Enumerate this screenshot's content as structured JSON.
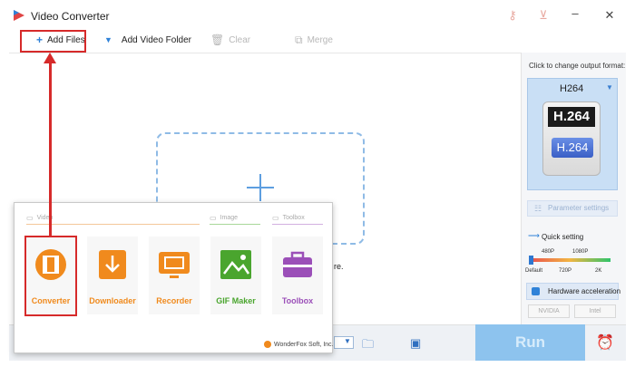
{
  "window": {
    "title": "Video Converter"
  },
  "toolbar": {
    "add_files": "Add Files",
    "add_video_folder": "Add Video Folder",
    "clear": "Clear",
    "merge": "Merge"
  },
  "main": {
    "drop_hint_tail": "re."
  },
  "right_panel": {
    "click_to_change": "Click to change output format:",
    "format_name": "H264",
    "format_badge_top": "H.264",
    "format_badge_bottom": "H.264",
    "parameter_settings": "Parameter settings",
    "quick_setting": "Quick setting",
    "quick_top_ticks": [
      "480P",
      "1080P"
    ],
    "quick_bottom_ticks": [
      "Default",
      "720P",
      "2K"
    ],
    "quick_level": 0,
    "hardware_acceleration": "Hardware acceleration",
    "gpu_nvidia": "NVIDIA",
    "gpu_intel": "Intel"
  },
  "bottom": {
    "run": "Run"
  },
  "popup": {
    "categories": {
      "video": "Video",
      "image": "Image",
      "toolbox": "Toolbox"
    },
    "tools": [
      {
        "label": "Converter",
        "color": "#f08a1d"
      },
      {
        "label": "Downloader",
        "color": "#f08a1d"
      },
      {
        "label": "Recorder",
        "color": "#f08a1d"
      },
      {
        "label": "GIF Maker",
        "color": "#4aa52e"
      },
      {
        "label": "Toolbox",
        "color": "#9b4fb8"
      }
    ],
    "brand": "WonderFox Soft, Inc."
  },
  "colors": {
    "accent": "#2f82d8",
    "highlight": "#d62a2a",
    "run": "#8dc3ee"
  }
}
